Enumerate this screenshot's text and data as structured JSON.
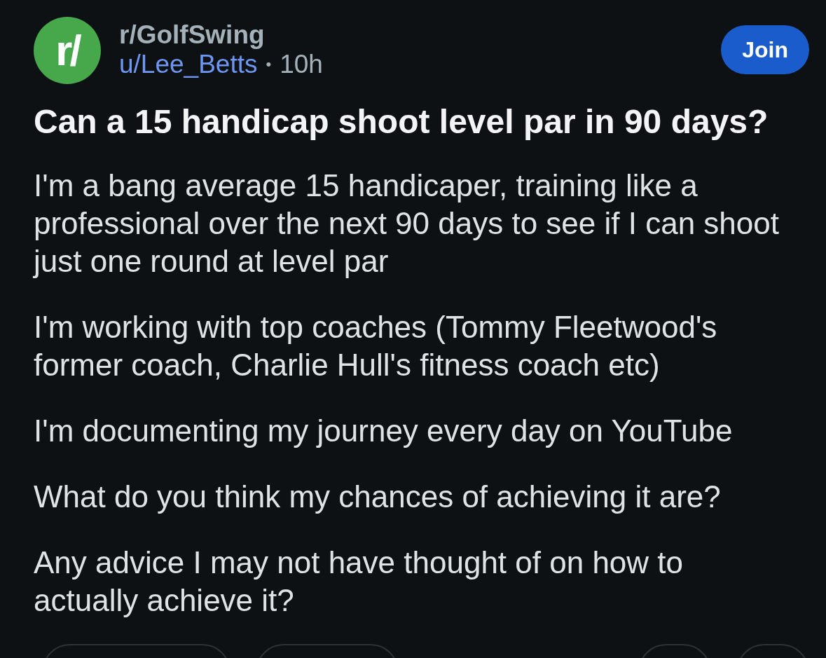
{
  "community": {
    "logo_text": "r/",
    "name": "r/GolfSwing",
    "author": "u/Lee_Betts",
    "separator": "•",
    "time": "10h"
  },
  "join_button": {
    "label": "Join"
  },
  "post": {
    "title": "Can a 15 handicap shoot level par in 90 days?",
    "paragraphs": [
      "I'm a bang average 15 handicaper, training like a professional over the next 90 days to see if I can shoot just one round at level par",
      "I'm working with top coaches (Tommy Fleetwood's former coach, Charlie Hull's fitness coach etc)",
      "I'm documenting my journey every day on YouTube",
      "What do you think my chances of achieving it are?",
      "Any advice I may not have thought of on how to actually achieve it?"
    ]
  },
  "action_bar": {
    "buttons": [
      {
        "kind": "wide"
      },
      {
        "kind": "medium"
      },
      {
        "kind": "small"
      },
      {
        "kind": "small"
      }
    ]
  }
}
